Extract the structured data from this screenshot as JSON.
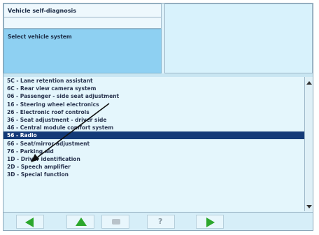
{
  "header": {
    "title": "Vehicle self-diagnosis",
    "instruction": "Select vehicle system"
  },
  "list": {
    "items": [
      "5C - Lane retention assistant",
      "6C - Rear view camera system",
      "06 - Passenger - side seat adjustment",
      "16 - Steering wheel electronics",
      "26 - Electronic roof controls",
      "36 - Seat adjustment - driver side",
      "46 - Central module comfort system",
      "56 - Radio",
      "66 - Seat/mirror adjustment",
      "76 - Parking aid",
      "1D - Driver identification",
      "2D - Speech amplifier",
      "3D - Special function"
    ],
    "selected_index": 7
  },
  "toolbar": {
    "buttons": [
      "back-icon",
      "up-icon",
      "print-icon",
      "help-icon",
      "forward-icon"
    ],
    "help_glyph": "?"
  },
  "colors": {
    "selection": "#143a78",
    "select_panel": "#8ed0f2",
    "arrow_green": "#2ca72c"
  }
}
